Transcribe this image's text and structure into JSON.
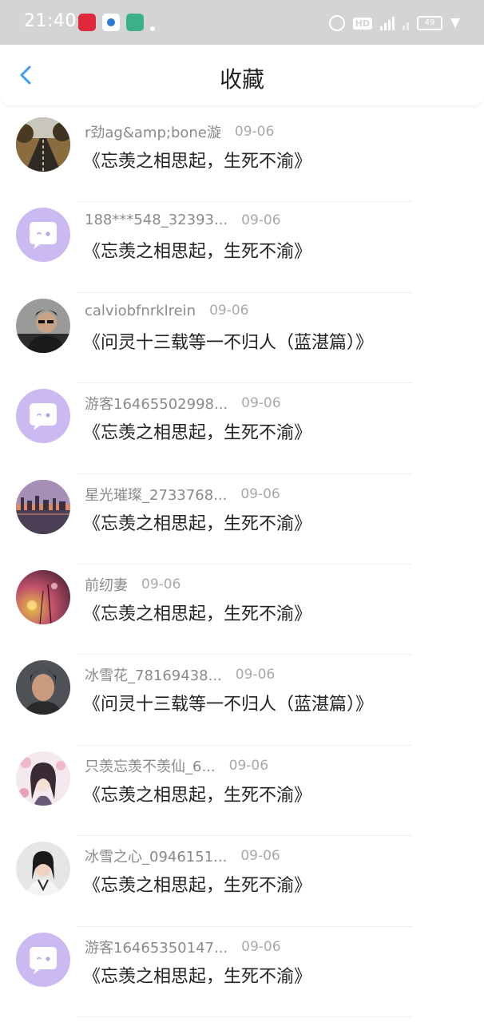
{
  "status_bar": {
    "time": "21:40",
    "hd_label": "HD",
    "battery": "49"
  },
  "header": {
    "title": "收藏",
    "back_icon": "chevron-left-icon"
  },
  "colors": {
    "accent": "#3a9ff0",
    "status_bar": "#d4d4d4",
    "default_avatar_bg": "#cbb9f2"
  },
  "favorites": [
    {
      "user": "r劲ag&amp;bone漩",
      "date": "09-06",
      "work": "《忘羡之相思起，生死不渝》",
      "avatar": "road-photo"
    },
    {
      "user": "188***548_32393...",
      "date": "09-06",
      "work": "《忘羡之相思起，生死不渝》",
      "avatar": "default-chat-avatar"
    },
    {
      "user": "calviobfnrklrein",
      "date": "09-06",
      "work": "《问灵十三载等一不归人（蓝湛篇）》",
      "avatar": "person-sunglasses-photo"
    },
    {
      "user": "游客16465502998...",
      "date": "09-06",
      "work": "《忘羡之相思起，生死不渝》",
      "avatar": "default-chat-avatar"
    },
    {
      "user": "星光璀璨_2733768...",
      "date": "09-06",
      "work": "《忘羡之相思起，生死不渝》",
      "avatar": "city-sunset-photo"
    },
    {
      "user": "前纫妻",
      "date": "09-06",
      "work": "《忘羡之相思起，生死不渝》",
      "avatar": "flower-bokeh-photo"
    },
    {
      "user": "冰雪花_78169438...",
      "date": "09-06",
      "work": "《问灵十三载等一不归人（蓝湛篇）》",
      "avatar": "person-portrait-photo"
    },
    {
      "user": "只羡忘羡不羡仙_6...",
      "date": "09-06",
      "work": "《忘羡之相思起，生死不渝》",
      "avatar": "anime-girl-illustration"
    },
    {
      "user": "冰雪之心_0946151...",
      "date": "09-06",
      "work": "《忘羡之相思起，生死不渝》",
      "avatar": "woman-portrait-photo"
    },
    {
      "user": "游客16465350147...",
      "date": "09-06",
      "work": "《忘羡之相思起，生死不渝》",
      "avatar": "default-chat-avatar"
    }
  ]
}
